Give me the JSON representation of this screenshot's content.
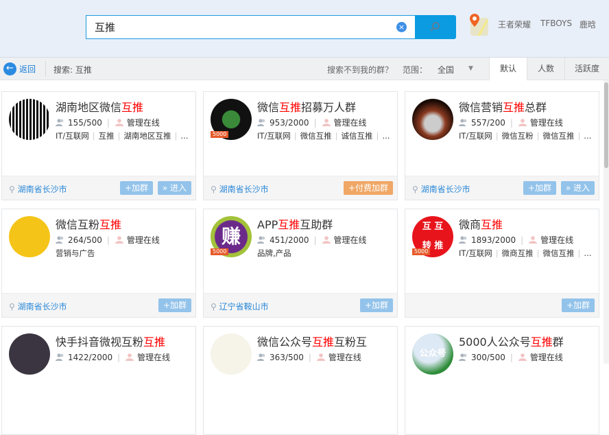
{
  "search": {
    "value": "互推",
    "clear_icon": "×"
  },
  "hot_searches": [
    "王者荣耀",
    "TFBOYS",
    "鹿晗"
  ],
  "toolbar": {
    "back": "返回",
    "search_label": "搜索: 互推",
    "not_found": "搜索不到我的群？",
    "range_label": "范围：",
    "range_value": "全国",
    "sort_tabs": [
      "默认",
      "人数",
      "活跃度"
    ]
  },
  "admin_status": "管理在线",
  "colors": {
    "accent": "#0b9be0",
    "highlight": "#ff0000",
    "button": "#93c3ea",
    "pay_button": "#f0a766"
  },
  "cards": [
    {
      "title_pre": "湖南地区微信",
      "title_hl": "互推",
      "title_post": "",
      "members": "155/500",
      "tags": [
        "IT/互联网",
        "互推",
        "湖南地区互推",
        "..."
      ],
      "location": "湖南省长沙市",
      "badge": "",
      "buttons": [
        "» 进入",
        "+加群"
      ],
      "avatar": "qr"
    },
    {
      "title_pre": "微信",
      "title_hl": "互推",
      "title_post": "招募万人群",
      "members": "953/2000",
      "tags": [
        "IT/互联网",
        "微信互推",
        "诚信互推",
        "..."
      ],
      "location": "湖南省长沙市",
      "badge": "5000",
      "buttons": [
        "+付费加群"
      ],
      "avatar": "hands"
    },
    {
      "title_pre": "微信营销",
      "title_hl": "互推",
      "title_post": "总群",
      "members": "557/200",
      "tags": [
        "IT/互联网",
        "微信互粉",
        "微信互推",
        "..."
      ],
      "location": "湖南省长沙市",
      "badge": "",
      "buttons": [
        "» 进入",
        "+加群"
      ],
      "avatar": "coins"
    },
    {
      "title_pre": "微信互粉",
      "title_hl": "互推",
      "title_post": "",
      "members": "264/500",
      "tags": [
        "营销与广告"
      ],
      "location": "湖南省长沙市",
      "badge": "",
      "buttons": [
        "+加群"
      ],
      "avatar": "yellow"
    },
    {
      "title_pre": "APP",
      "title_hl": "互推",
      "title_post": "互助群",
      "members": "451/2000",
      "tags": [
        "品牌,产品"
      ],
      "location": "辽宁省鞍山市",
      "badge": "5000",
      "buttons": [
        "+加群"
      ],
      "avatar": "zhuan",
      "avatar_text": "赚"
    },
    {
      "title_pre": "微商",
      "title_hl": "互推",
      "title_post": "",
      "members": "1893/2000",
      "tags": [
        "IT/互联网",
        "微商互推",
        "微信互推",
        "..."
      ],
      "location": "",
      "badge": "5000",
      "buttons": [
        "+加群"
      ],
      "avatar": "red",
      "avatar_text": "互 互 转 推"
    },
    {
      "title_pre": "快手抖音微视互粉",
      "title_hl": "互推",
      "title_post": "",
      "members": "1422/2000",
      "tags": [],
      "location": "",
      "badge": "",
      "buttons": [],
      "avatar": "dark"
    },
    {
      "title_pre": "微信公众号",
      "title_hl": "互推",
      "title_post": "互粉互",
      "members": "363/500",
      "tags": [],
      "location": "",
      "badge": "",
      "buttons": [],
      "avatar": "cartoon"
    },
    {
      "title_pre": "5000人公众号",
      "title_hl": "互推",
      "title_post": "群",
      "members": "300/500",
      "tags": [],
      "location": "",
      "badge": "",
      "buttons": [],
      "avatar": "wechat",
      "avatar_text": "公众号"
    }
  ]
}
